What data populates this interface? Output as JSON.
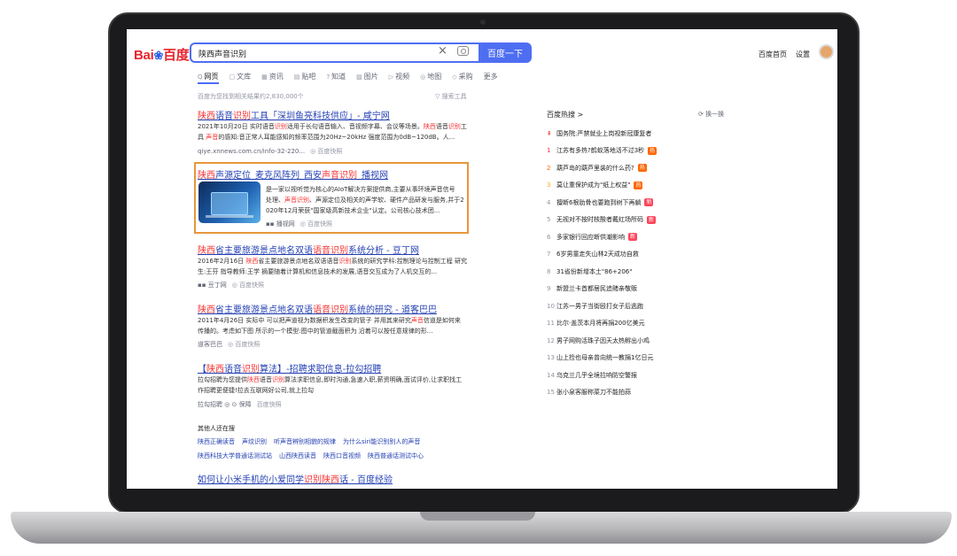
{
  "header": {
    "logo_left": "Bai",
    "logo_paw": "❀",
    "logo_right": "百度",
    "query": "陕西声音识别",
    "search_button": "百度一下",
    "links": [
      "百度首页",
      "设置"
    ]
  },
  "tabs": [
    {
      "icon": "Q",
      "label": "网页"
    },
    {
      "icon": "▢",
      "label": "文库"
    },
    {
      "icon": "▦",
      "label": "资讯"
    },
    {
      "icon": "▤",
      "label": "贴吧"
    },
    {
      "icon": "?",
      "label": "知道"
    },
    {
      "icon": "▨",
      "label": "图片"
    },
    {
      "icon": "▷",
      "label": "视频"
    },
    {
      "icon": "◎",
      "label": "地图"
    },
    {
      "icon": "◇",
      "label": "采购"
    },
    {
      "icon": "",
      "label": "更多"
    }
  ],
  "result_count": "百度为您找到相关结果约2,830,000个",
  "search_tools": "▽ 搜索工具",
  "results": [
    {
      "title_parts": [
        {
          "t": "陕西",
          "hl": true
        },
        {
          "t": "语音",
          "hl": false
        },
        {
          "t": "识别",
          "hl": true
        },
        {
          "t": "工具「深圳鱼亮科技供应」- 咸宁网",
          "hl": false
        }
      ],
      "desc_lines": [
        [
          {
            "t": "2021年10月20日 实时语音",
            "hl": false
          },
          {
            "t": "识别",
            "hl": true
          },
          {
            "t": "适用于长句语音输入、音视频字幕、会议等场景。",
            "hl": false
          },
          {
            "t": "陕西",
            "hl": true
          },
          {
            "t": "语音",
            "hl": false
          },
          {
            "t": "识别",
            "hl": true
          },
          {
            "t": "工",
            "hl": false
          }
        ],
        [
          {
            "t": "具 ",
            "hl": false
          },
          {
            "t": "声音",
            "hl": true
          },
          {
            "t": "的感知:音正常人耳能感知的频率范围为20Hz~20kHz 强度范围为0dB~120dB。人...",
            "hl": false
          }
        ]
      ],
      "meta": "qiye.xnnews.com.cn/info-32-220...",
      "snap": "◎ 百度快照"
    },
    {
      "title_parts": [
        {
          "t": "陕西",
          "hl": true
        },
        {
          "t": "声源定位_麦克风阵列_西安",
          "hl": false
        },
        {
          "t": "声音识别",
          "hl": true
        },
        {
          "t": "_播视网",
          "hl": false
        }
      ],
      "desc_lines": [
        [
          {
            "t": "是一家以视听觉为核心的AIoT解决方案提供商,主要从事环境声音信号",
            "hl": false
          }
        ],
        [
          {
            "t": "处理、",
            "hl": false
          },
          {
            "t": "声音识别",
            "hl": true
          },
          {
            "t": "、声源定位及相关的声学软、硬件产品研发与服务,并于2",
            "hl": false
          }
        ],
        [
          {
            "t": "020年12月荣获\"国家级高新技术企业\"认定。公司核心技术团...",
            "hl": false
          }
        ]
      ],
      "meta": "▪▪ 播视网",
      "snap": "◎ 百度快照"
    },
    {
      "title_parts": [
        {
          "t": "陕西",
          "hl": true
        },
        {
          "t": "省主要旅游景点地名双语",
          "hl": false
        },
        {
          "t": "语音识别",
          "hl": true
        },
        {
          "t": "系统分析 - 豆丁网",
          "hl": false
        }
      ],
      "desc_lines": [
        [
          {
            "t": "2016年2月16日 ",
            "hl": false
          },
          {
            "t": "陕西",
            "hl": true
          },
          {
            "t": "省主要旅游景点地名双语语音",
            "hl": false
          },
          {
            "t": "识别",
            "hl": true
          },
          {
            "t": "系统的研究学科:控制理论与控制工程 研究",
            "hl": false
          }
        ],
        [
          {
            "t": "生:王芬 指导教师:王学 摘要随着计算机和信息技术的发展,语音交互成为了人机交互的...",
            "hl": false
          }
        ]
      ],
      "meta": "▪▪ 豆丁网",
      "snap": "◎ 百度快照"
    },
    {
      "title_parts": [
        {
          "t": "陕西",
          "hl": true
        },
        {
          "t": "省主要旅游景点地名双语",
          "hl": false
        },
        {
          "t": "语音识别",
          "hl": true
        },
        {
          "t": "系统的研究 - 道客巴巴",
          "hl": false
        }
      ],
      "desc_lines": [
        [
          {
            "t": "2011年4月26日 实际中 可以把声道视为数据积发生改变的管子 并用其来研究",
            "hl": false
          },
          {
            "t": "声音",
            "hl": true
          },
          {
            "t": "信道是如何来",
            "hl": false
          }
        ],
        [
          {
            "t": "传播的。考虑如下图 所示的一个模型:图中的管道截面积为 沿着可以按任意规律的形...",
            "hl": false
          }
        ]
      ],
      "meta": "道客巴巴",
      "snap": "◎ 百度快照"
    },
    {
      "title_parts": [
        {
          "t": "【",
          "hl": false
        },
        {
          "t": "陕西",
          "hl": true
        },
        {
          "t": "语音",
          "hl": false
        },
        {
          "t": "识别",
          "hl": true
        },
        {
          "t": "算法】-招聘求职信息-拉勾招聘",
          "hl": false
        }
      ],
      "desc_lines": [
        [
          {
            "t": "拉勾招聘为您提供",
            "hl": false
          },
          {
            "t": "陕西",
            "hl": true
          },
          {
            "t": "语音",
            "hl": false
          },
          {
            "t": "识别",
            "hl": true
          },
          {
            "t": "算法求职信息,即时沟通,急速入职,薪资明确,面试评价,让求职找工",
            "hl": false
          }
        ],
        [
          {
            "t": "作招聘更便捷!拉去互联网好公司,就上拉勾",
            "hl": false
          }
        ]
      ],
      "meta": "拉勾招聘 ◎ ⊙ 保障",
      "snap": "百度快照"
    }
  ],
  "also_search": {
    "title": "其他人还在搜",
    "rows": [
      [
        "陕西正确读音",
        "声纹识别",
        "听声音辨别相貌的规律",
        "为什么siri能识别别人的声音"
      ],
      [
        "陕西科技大学普通话测试站",
        "山西陕西读音",
        "陕西口音视频",
        "陕西普通话测试中心"
      ]
    ]
  },
  "last_result": {
    "title_parts": [
      {
        "t": "如何让小米手机的小爱同学",
        "hl": false
      },
      {
        "t": "识别陕西",
        "hl": true
      },
      {
        "t": "话 - 百度经验",
        "hl": false
      }
    ]
  },
  "hot": {
    "title": "百度热搜 >",
    "refresh": "⟳ 换一换",
    "items": [
      {
        "num": "⇞",
        "text": "国务院:严禁就业上岗视新冠康复者",
        "badge": ""
      },
      {
        "num": "1",
        "text": "江苏有多热?鹤蚁落地活不过3秒",
        "badge": "热"
      },
      {
        "num": "2",
        "text": "葫芦岛的葫芦里装的什么药?",
        "badge": "热"
      },
      {
        "num": "3",
        "text": "莫让重保护成为\"纸上权益\"",
        "badge": "热"
      },
      {
        "num": "4",
        "text": "擅断6根肋骨也要跑到树下再躺",
        "badge": "新"
      },
      {
        "num": "5",
        "text": "无视对不按时核酸者戴红场所码",
        "badge": "新"
      },
      {
        "num": "6",
        "text": "多家银行回应断供潮影响",
        "badge": "新"
      },
      {
        "num": "7",
        "text": "6岁男童走失山林2天成功自救",
        "badge": ""
      },
      {
        "num": "8",
        "text": "31省份新增本土\"86+206\"",
        "badge": ""
      },
      {
        "num": "9",
        "text": "新盟兰卡首都居民追赌亲敬贩",
        "badge": ""
      },
      {
        "num": "10",
        "text": "江苏一男子当街殴打女子后逃跑",
        "badge": ""
      },
      {
        "num": "11",
        "text": "比尔·盖茨本月将再捐200亿美元",
        "badge": ""
      },
      {
        "num": "12",
        "text": "男子网购活珠子因天太热孵出小鸡",
        "badge": ""
      },
      {
        "num": "13",
        "text": "山上捡也母亲曾向统一教捐1亿日元",
        "badge": ""
      },
      {
        "num": "14",
        "text": "乌克兰几乎全境拉响防空警报",
        "badge": ""
      },
      {
        "num": "15",
        "text": "张小泉客服称菜刀不能拍蒜",
        "badge": ""
      }
    ]
  }
}
